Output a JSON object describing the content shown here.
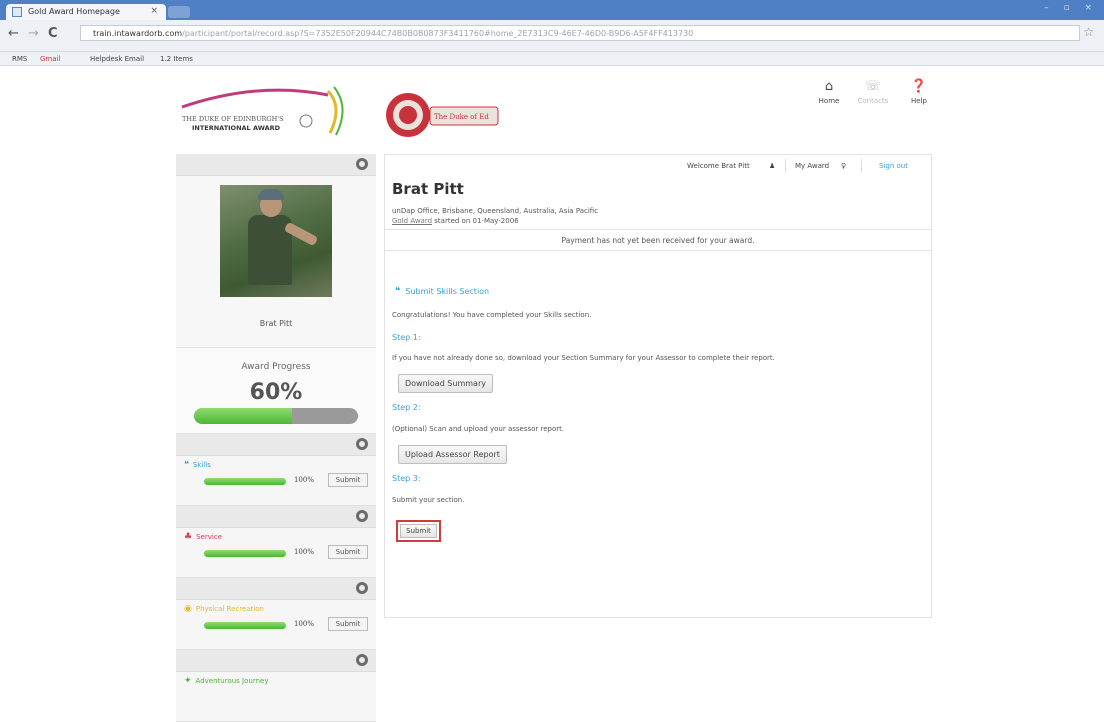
{
  "browser": {
    "tab_title": "Gold Award Homepage",
    "tab_close": "×",
    "window_controls": "– ▫ ×",
    "url_host": "train.intawardorb.com",
    "url_path": "/participant/portal/record.asp?S=7352E50F20944C74B0B0B0873F3411760#home_2E7313C9-46E7-46D0-B9D6-A5F4FF413730",
    "bookmarks": [
      "RMS",
      "Gmail",
      "Helpdesk Email",
      "1.2 Items"
    ]
  },
  "header": {
    "dofe_logo_text_1": "THE DUKE OF EDINBURGH'S",
    "dofe_logo_text_2": "INTERNATIONAL AWARD",
    "seal_text": "The Duke of Ed",
    "nav": [
      {
        "label": "Home",
        "icon": "home-icon"
      },
      {
        "label": "Contacts",
        "icon": "contacts-icon"
      },
      {
        "label": "Help",
        "icon": "help-icon"
      }
    ]
  },
  "sidebar": {
    "profile_name": "Brat Pitt",
    "progress_label": "Award Progress",
    "progress_value": "60%",
    "progress_fraction": 0.6,
    "sections": [
      {
        "title": "Skills",
        "color": "#3aa0d6",
        "icon": "speech-bubble-icon",
        "pct": "100%",
        "button": "Submit"
      },
      {
        "title": "Service",
        "color": "#d64058",
        "icon": "people-icon",
        "pct": "100%",
        "button": "Submit"
      },
      {
        "title": "Physical Recreation",
        "color": "#e8b92a",
        "icon": "runner-icon",
        "pct": "100%",
        "button": "Submit"
      },
      {
        "title": "Adventurous Journey",
        "color": "#4db636",
        "icon": "compass-icon",
        "pct": "",
        "button": ""
      }
    ]
  },
  "main": {
    "welcome": "Welcome Brat Pitt",
    "my_award": "My Award",
    "sign_out": "Sign out",
    "name": "Brat Pitt",
    "location": "unDap Office, Brisbane, Queensland, Australia, Asia Pacific",
    "award_link": "Gold Award",
    "started": "started on 01-May-2006",
    "payment_notice": "Payment has not yet been received for your award.",
    "section_title": "Submit Skills Section",
    "congrats": "Congratulations! You have completed your Skills section.",
    "step1_title": "Step 1:",
    "step1_text": "If you have not already done so, download your Section Summary for your Assessor to complete their report.",
    "download_btn": "Download Summary",
    "step2_title": "Step 2:",
    "step2_text": "(Optional) Scan and upload your assessor report.",
    "upload_btn": "Upload Assessor Report",
    "step3_title": "Step 3:",
    "step3_text": "Submit your section.",
    "submit_btn": "Submit"
  },
  "colors": {
    "accent": "#3aa0d6",
    "highlight": "#d23b3b",
    "progress_green": "#4db636"
  }
}
